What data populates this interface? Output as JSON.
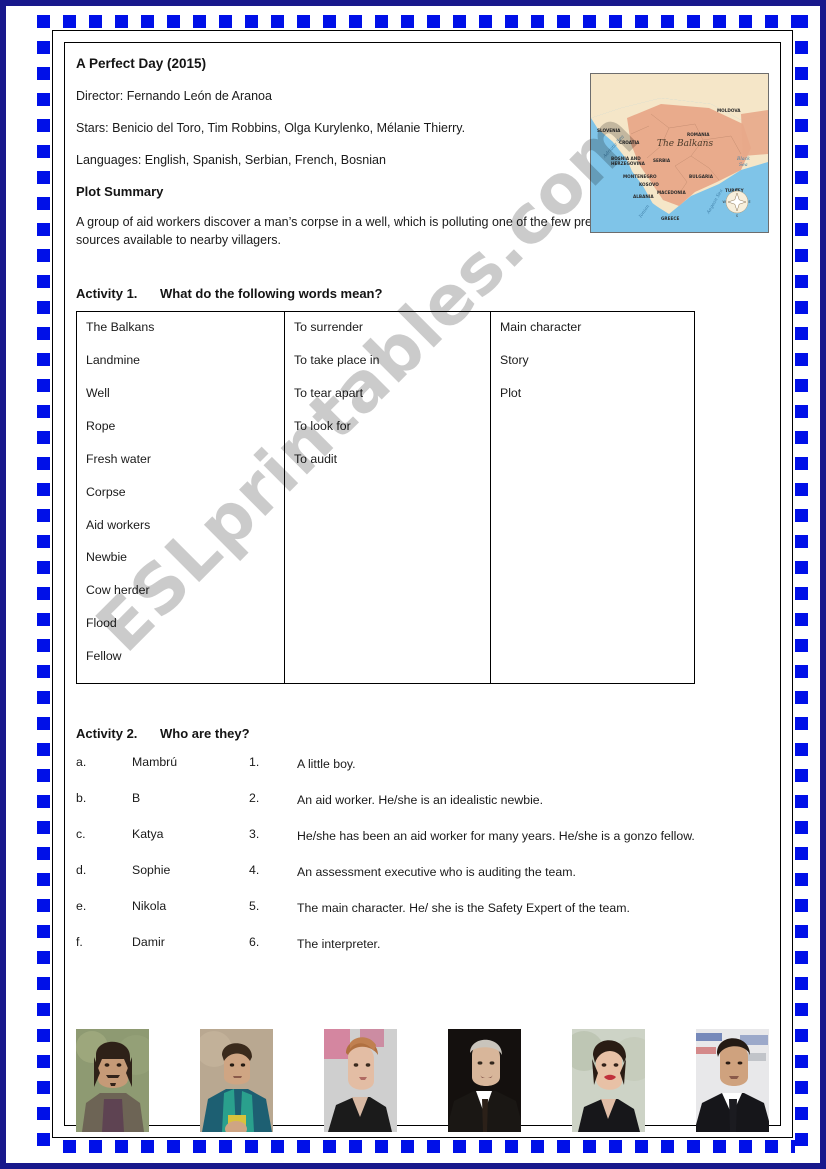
{
  "document": {
    "title": "A Perfect Day (2015)",
    "director_line": "Director: Fernando León de Aranoa",
    "stars_line": "Stars: Benicio del Toro, Tim Robbins, Olga Kurylenko, Mélanie Thierry.",
    "languages_line": "Languages: English, Spanish, Serbian, French, Bosnian",
    "plot_heading": "Plot Summary",
    "plot_body": "A group of aid workers discover a man’s corpse in a well, which is polluting one of the few precious water sources available to nearby villagers."
  },
  "map": {
    "title": "The Balkans",
    "labels": [
      "SLOVENIA",
      "CROATIA",
      "BOSNIA AND HERZEGOVINA",
      "MONTENEGRO",
      "KOSOVO",
      "SERBIA",
      "ALBANIA",
      "MACEDONIA",
      "GREECE",
      "BULGARIA",
      "ROMANIA",
      "MOLDOVA",
      "TURKEY"
    ],
    "sea_labels": [
      "Adriatic Sea",
      "Black Sea",
      "Aegean Sea",
      "Ionian Sea"
    ],
    "compass": {
      "north": "N",
      "south": "S",
      "east": "E",
      "west": "W"
    },
    "colors": {
      "land_highlight": "#e8a889",
      "land_plain": "#f5e6c8",
      "sea": "#7fc4e8"
    }
  },
  "activity1": {
    "number": "Activity 1.",
    "prompt": "What do the following words mean?",
    "columns": [
      [
        "The Balkans",
        "Landmine",
        "Well",
        "Rope",
        "Fresh water",
        "Corpse",
        "Aid workers",
        "Newbie",
        "Cow herder",
        "Flood",
        "Fellow"
      ],
      [
        "To surrender",
        "To take place in",
        "To tear apart",
        "To look for",
        "To audit"
      ],
      [
        "Main character",
        "Story",
        "Plot"
      ]
    ]
  },
  "activity2": {
    "number": "Activity 2.",
    "prompt": "Who are they?",
    "rows": [
      {
        "letter": "a.",
        "name": "Mambrú",
        "num": "1.",
        "desc": "A little boy."
      },
      {
        "letter": "b.",
        "name": "B",
        "num": "2.",
        "desc": "An aid worker. He/she is an idealistic newbie."
      },
      {
        "letter": "c.",
        "name": "Katya",
        "num": "3.",
        "desc": "He/she has been an aid worker for many years. He/she is a gonzo fellow."
      },
      {
        "letter": "d.",
        "name": "Sophie",
        "num": "4.",
        "desc": "An assessment executive who is auditing the team."
      },
      {
        "letter": "e.",
        "name": "Nikola",
        "num": "5.",
        "desc": "The main character. He/ she is the Safety Expert of the team."
      },
      {
        "letter": "f.",
        "name": "Damir",
        "num": "6.",
        "desc": "The interpreter."
      }
    ]
  },
  "photos": [
    {
      "name": "photo-man-long-hair-moustache"
    },
    {
      "name": "photo-boy-teal-jacket"
    },
    {
      "name": "photo-woman-updo-hair"
    },
    {
      "name": "photo-older-man-suit"
    },
    {
      "name": "photo-woman-red-lipstick"
    },
    {
      "name": "photo-man-dark-hair-suit"
    }
  ],
  "watermark": {
    "text": "ESLprintables.com"
  },
  "colors": {
    "border_blue": "#0010e8",
    "border_navy": "#18188c",
    "text": "#1a1a1a"
  }
}
